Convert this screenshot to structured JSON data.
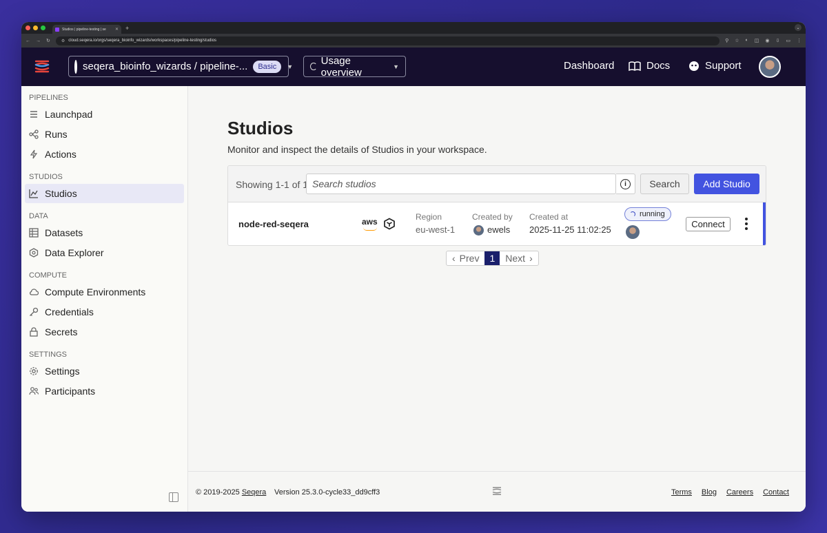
{
  "browser": {
    "tab_title": "Studios | pipeline-testing | se",
    "url": "cloud.seqera.io/orgs/seqera_bioinfo_wizards/workspaces/pipeline-testing/studios"
  },
  "header": {
    "org_workspace": "seqera_bioinfo_wizards / pipeline-...",
    "plan_badge": "Basic",
    "usage_label": "Usage overview",
    "links": {
      "dashboard": "Dashboard",
      "docs": "Docs",
      "support": "Support"
    }
  },
  "sidebar": {
    "sections": [
      {
        "title": "PIPELINES",
        "items": [
          "Launchpad",
          "Runs",
          "Actions"
        ]
      },
      {
        "title": "STUDIOS",
        "items": [
          "Studios"
        ]
      },
      {
        "title": "DATA",
        "items": [
          "Datasets",
          "Data Explorer"
        ]
      },
      {
        "title": "COMPUTE",
        "items": [
          "Compute Environments",
          "Credentials",
          "Secrets"
        ]
      },
      {
        "title": "SETTINGS",
        "items": [
          "Settings",
          "Participants"
        ]
      }
    ],
    "active_item": "Studios"
  },
  "main": {
    "title": "Studios",
    "subtitle": "Monitor and inspect the details of Studios in your workspace.",
    "showing": "Showing 1-1 of 1",
    "search_placeholder": "Search studios",
    "search_button": "Search",
    "add_button": "Add Studio",
    "studio": {
      "name": "node-red-seqera",
      "provider": "aws",
      "region_label": "Region",
      "region": "eu-west-1",
      "created_by_label": "Created by",
      "created_by": "ewels",
      "created_at_label": "Created at",
      "created_at": "2025-11-25 11:02:25",
      "status": "running",
      "connect_label": "Connect"
    },
    "pager": {
      "prev": "Prev",
      "current": "1",
      "next": "Next"
    }
  },
  "footer": {
    "copyright": "© 2019-2025",
    "company": "Seqera",
    "version": "Version 25.3.0-cycle33_dd9cff3",
    "links": {
      "terms": "Terms",
      "blog": "Blog",
      "careers": "Careers",
      "contact": "Contact"
    }
  },
  "colors": {
    "accent": "#4253e0",
    "header_bg": "#160f2e",
    "active_page": "#1a1f6b"
  }
}
